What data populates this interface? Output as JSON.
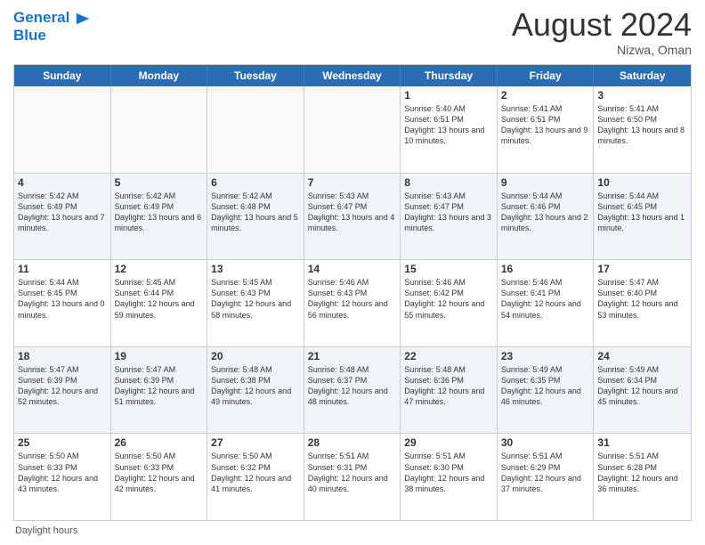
{
  "header": {
    "logo_line1": "General",
    "logo_line2": "Blue",
    "title": "August 2024",
    "subtitle": "Nizwa, Oman"
  },
  "days_of_week": [
    "Sunday",
    "Monday",
    "Tuesday",
    "Wednesday",
    "Thursday",
    "Friday",
    "Saturday"
  ],
  "footer": {
    "daylight_label": "Daylight hours"
  },
  "weeks": [
    [
      {
        "day": "",
        "info": ""
      },
      {
        "day": "",
        "info": ""
      },
      {
        "day": "",
        "info": ""
      },
      {
        "day": "",
        "info": ""
      },
      {
        "day": "1",
        "info": "Sunrise: 5:40 AM\nSunset: 6:51 PM\nDaylight: 13 hours and 10 minutes."
      },
      {
        "day": "2",
        "info": "Sunrise: 5:41 AM\nSunset: 6:51 PM\nDaylight: 13 hours and 9 minutes."
      },
      {
        "day": "3",
        "info": "Sunrise: 5:41 AM\nSunset: 6:50 PM\nDaylight: 13 hours and 8 minutes."
      }
    ],
    [
      {
        "day": "4",
        "info": "Sunrise: 5:42 AM\nSunset: 6:49 PM\nDaylight: 13 hours and 7 minutes."
      },
      {
        "day": "5",
        "info": "Sunrise: 5:42 AM\nSunset: 6:49 PM\nDaylight: 13 hours and 6 minutes."
      },
      {
        "day": "6",
        "info": "Sunrise: 5:42 AM\nSunset: 6:48 PM\nDaylight: 13 hours and 5 minutes."
      },
      {
        "day": "7",
        "info": "Sunrise: 5:43 AM\nSunset: 6:47 PM\nDaylight: 13 hours and 4 minutes."
      },
      {
        "day": "8",
        "info": "Sunrise: 5:43 AM\nSunset: 6:47 PM\nDaylight: 13 hours and 3 minutes."
      },
      {
        "day": "9",
        "info": "Sunrise: 5:44 AM\nSunset: 6:46 PM\nDaylight: 13 hours and 2 minutes."
      },
      {
        "day": "10",
        "info": "Sunrise: 5:44 AM\nSunset: 6:45 PM\nDaylight: 13 hours and 1 minute."
      }
    ],
    [
      {
        "day": "11",
        "info": "Sunrise: 5:44 AM\nSunset: 6:45 PM\nDaylight: 13 hours and 0 minutes."
      },
      {
        "day": "12",
        "info": "Sunrise: 5:45 AM\nSunset: 6:44 PM\nDaylight: 12 hours and 59 minutes."
      },
      {
        "day": "13",
        "info": "Sunrise: 5:45 AM\nSunset: 6:43 PM\nDaylight: 12 hours and 58 minutes."
      },
      {
        "day": "14",
        "info": "Sunrise: 5:46 AM\nSunset: 6:43 PM\nDaylight: 12 hours and 56 minutes."
      },
      {
        "day": "15",
        "info": "Sunrise: 5:46 AM\nSunset: 6:42 PM\nDaylight: 12 hours and 55 minutes."
      },
      {
        "day": "16",
        "info": "Sunrise: 5:46 AM\nSunset: 6:41 PM\nDaylight: 12 hours and 54 minutes."
      },
      {
        "day": "17",
        "info": "Sunrise: 5:47 AM\nSunset: 6:40 PM\nDaylight: 12 hours and 53 minutes."
      }
    ],
    [
      {
        "day": "18",
        "info": "Sunrise: 5:47 AM\nSunset: 6:39 PM\nDaylight: 12 hours and 52 minutes."
      },
      {
        "day": "19",
        "info": "Sunrise: 5:47 AM\nSunset: 6:39 PM\nDaylight: 12 hours and 51 minutes."
      },
      {
        "day": "20",
        "info": "Sunrise: 5:48 AM\nSunset: 6:38 PM\nDaylight: 12 hours and 49 minutes."
      },
      {
        "day": "21",
        "info": "Sunrise: 5:48 AM\nSunset: 6:37 PM\nDaylight: 12 hours and 48 minutes."
      },
      {
        "day": "22",
        "info": "Sunrise: 5:48 AM\nSunset: 6:36 PM\nDaylight: 12 hours and 47 minutes."
      },
      {
        "day": "23",
        "info": "Sunrise: 5:49 AM\nSunset: 6:35 PM\nDaylight: 12 hours and 46 minutes."
      },
      {
        "day": "24",
        "info": "Sunrise: 5:49 AM\nSunset: 6:34 PM\nDaylight: 12 hours and 45 minutes."
      }
    ],
    [
      {
        "day": "25",
        "info": "Sunrise: 5:50 AM\nSunset: 6:33 PM\nDaylight: 12 hours and 43 minutes."
      },
      {
        "day": "26",
        "info": "Sunrise: 5:50 AM\nSunset: 6:33 PM\nDaylight: 12 hours and 42 minutes."
      },
      {
        "day": "27",
        "info": "Sunrise: 5:50 AM\nSunset: 6:32 PM\nDaylight: 12 hours and 41 minutes."
      },
      {
        "day": "28",
        "info": "Sunrise: 5:51 AM\nSunset: 6:31 PM\nDaylight: 12 hours and 40 minutes."
      },
      {
        "day": "29",
        "info": "Sunrise: 5:51 AM\nSunset: 6:30 PM\nDaylight: 12 hours and 38 minutes."
      },
      {
        "day": "30",
        "info": "Sunrise: 5:51 AM\nSunset: 6:29 PM\nDaylight: 12 hours and 37 minutes."
      },
      {
        "day": "31",
        "info": "Sunrise: 5:51 AM\nSunset: 6:28 PM\nDaylight: 12 hours and 36 minutes."
      }
    ]
  ]
}
